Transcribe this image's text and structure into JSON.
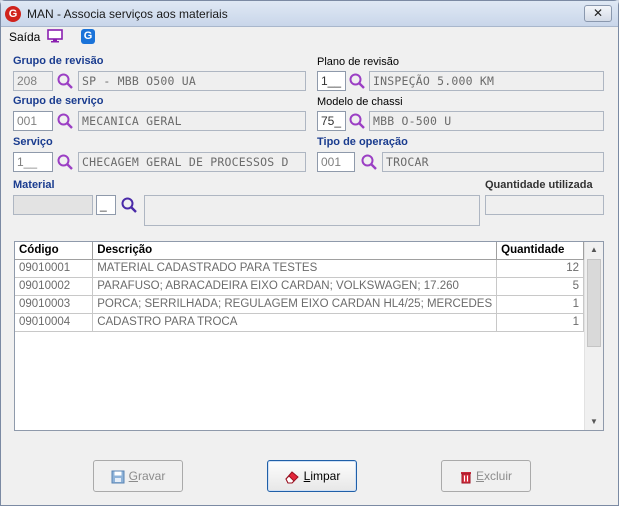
{
  "window": {
    "title": "MAN - Associa serviços aos materiais",
    "close": "✕",
    "app_icon_letter": "G"
  },
  "menu": {
    "saida": "Saída",
    "icons": [
      "monitor-icon",
      "g-logo-icon"
    ]
  },
  "form": {
    "grupo_revisao": {
      "label": "Grupo de revisão",
      "code": "208",
      "desc": "SP - MBB O500 UA"
    },
    "plano_revisao": {
      "label": "Plano de revisão",
      "code": "1__",
      "desc": "INSPEÇÃO 5.000 KM"
    },
    "grupo_servico": {
      "label": "Grupo de serviço",
      "code": "001",
      "desc": "MECANICA GERAL"
    },
    "modelo_chassi": {
      "label": "Modelo de chassi",
      "code": "75_",
      "desc": "MBB O-500 U"
    },
    "servico": {
      "label": "Serviço",
      "code": "1__",
      "desc": "CHECAGEM GERAL DE PROCESSOS D"
    },
    "tipo_operacao": {
      "label": "Tipo de operação",
      "code": "001",
      "desc": "TROCAR"
    },
    "material": {
      "label": "Material",
      "code": "",
      "digit": "_",
      "desc": ""
    },
    "quantidade_utilizada": {
      "label": "Quantidade utilizada",
      "value": ""
    }
  },
  "grid": {
    "columns": [
      "Código",
      "Descrição",
      "Quantidade"
    ],
    "rows": [
      {
        "codigo": "09010001",
        "descricao": "MATERIAL CADASTRADO PARA TESTES",
        "quantidade": "12"
      },
      {
        "codigo": "09010002",
        "descricao": "PARAFUSO; ABRACADEIRA EIXO CARDAN; VOLKSWAGEN; 17.260",
        "quantidade": "5"
      },
      {
        "codigo": "09010003",
        "descricao": "PORCA; SERRILHADA; REGULAGEM EIXO CARDAN HL4/25; MERCEDES",
        "quantidade": "1"
      },
      {
        "codigo": "09010004",
        "descricao": "CADASTRO PARA TROCA",
        "quantidade": "1"
      }
    ]
  },
  "buttons": {
    "gravar_mnemonic": "G",
    "gravar_rest": "ravar",
    "limpar_mnemonic": "L",
    "limpar_rest": "impar",
    "excluir_mnemonic": "E",
    "excluir_rest": "xcluir"
  },
  "colors": {
    "label_blue": "#1a3c8f",
    "search_icon": "#9b3fc4",
    "focus_border": "#1f5fa8"
  }
}
